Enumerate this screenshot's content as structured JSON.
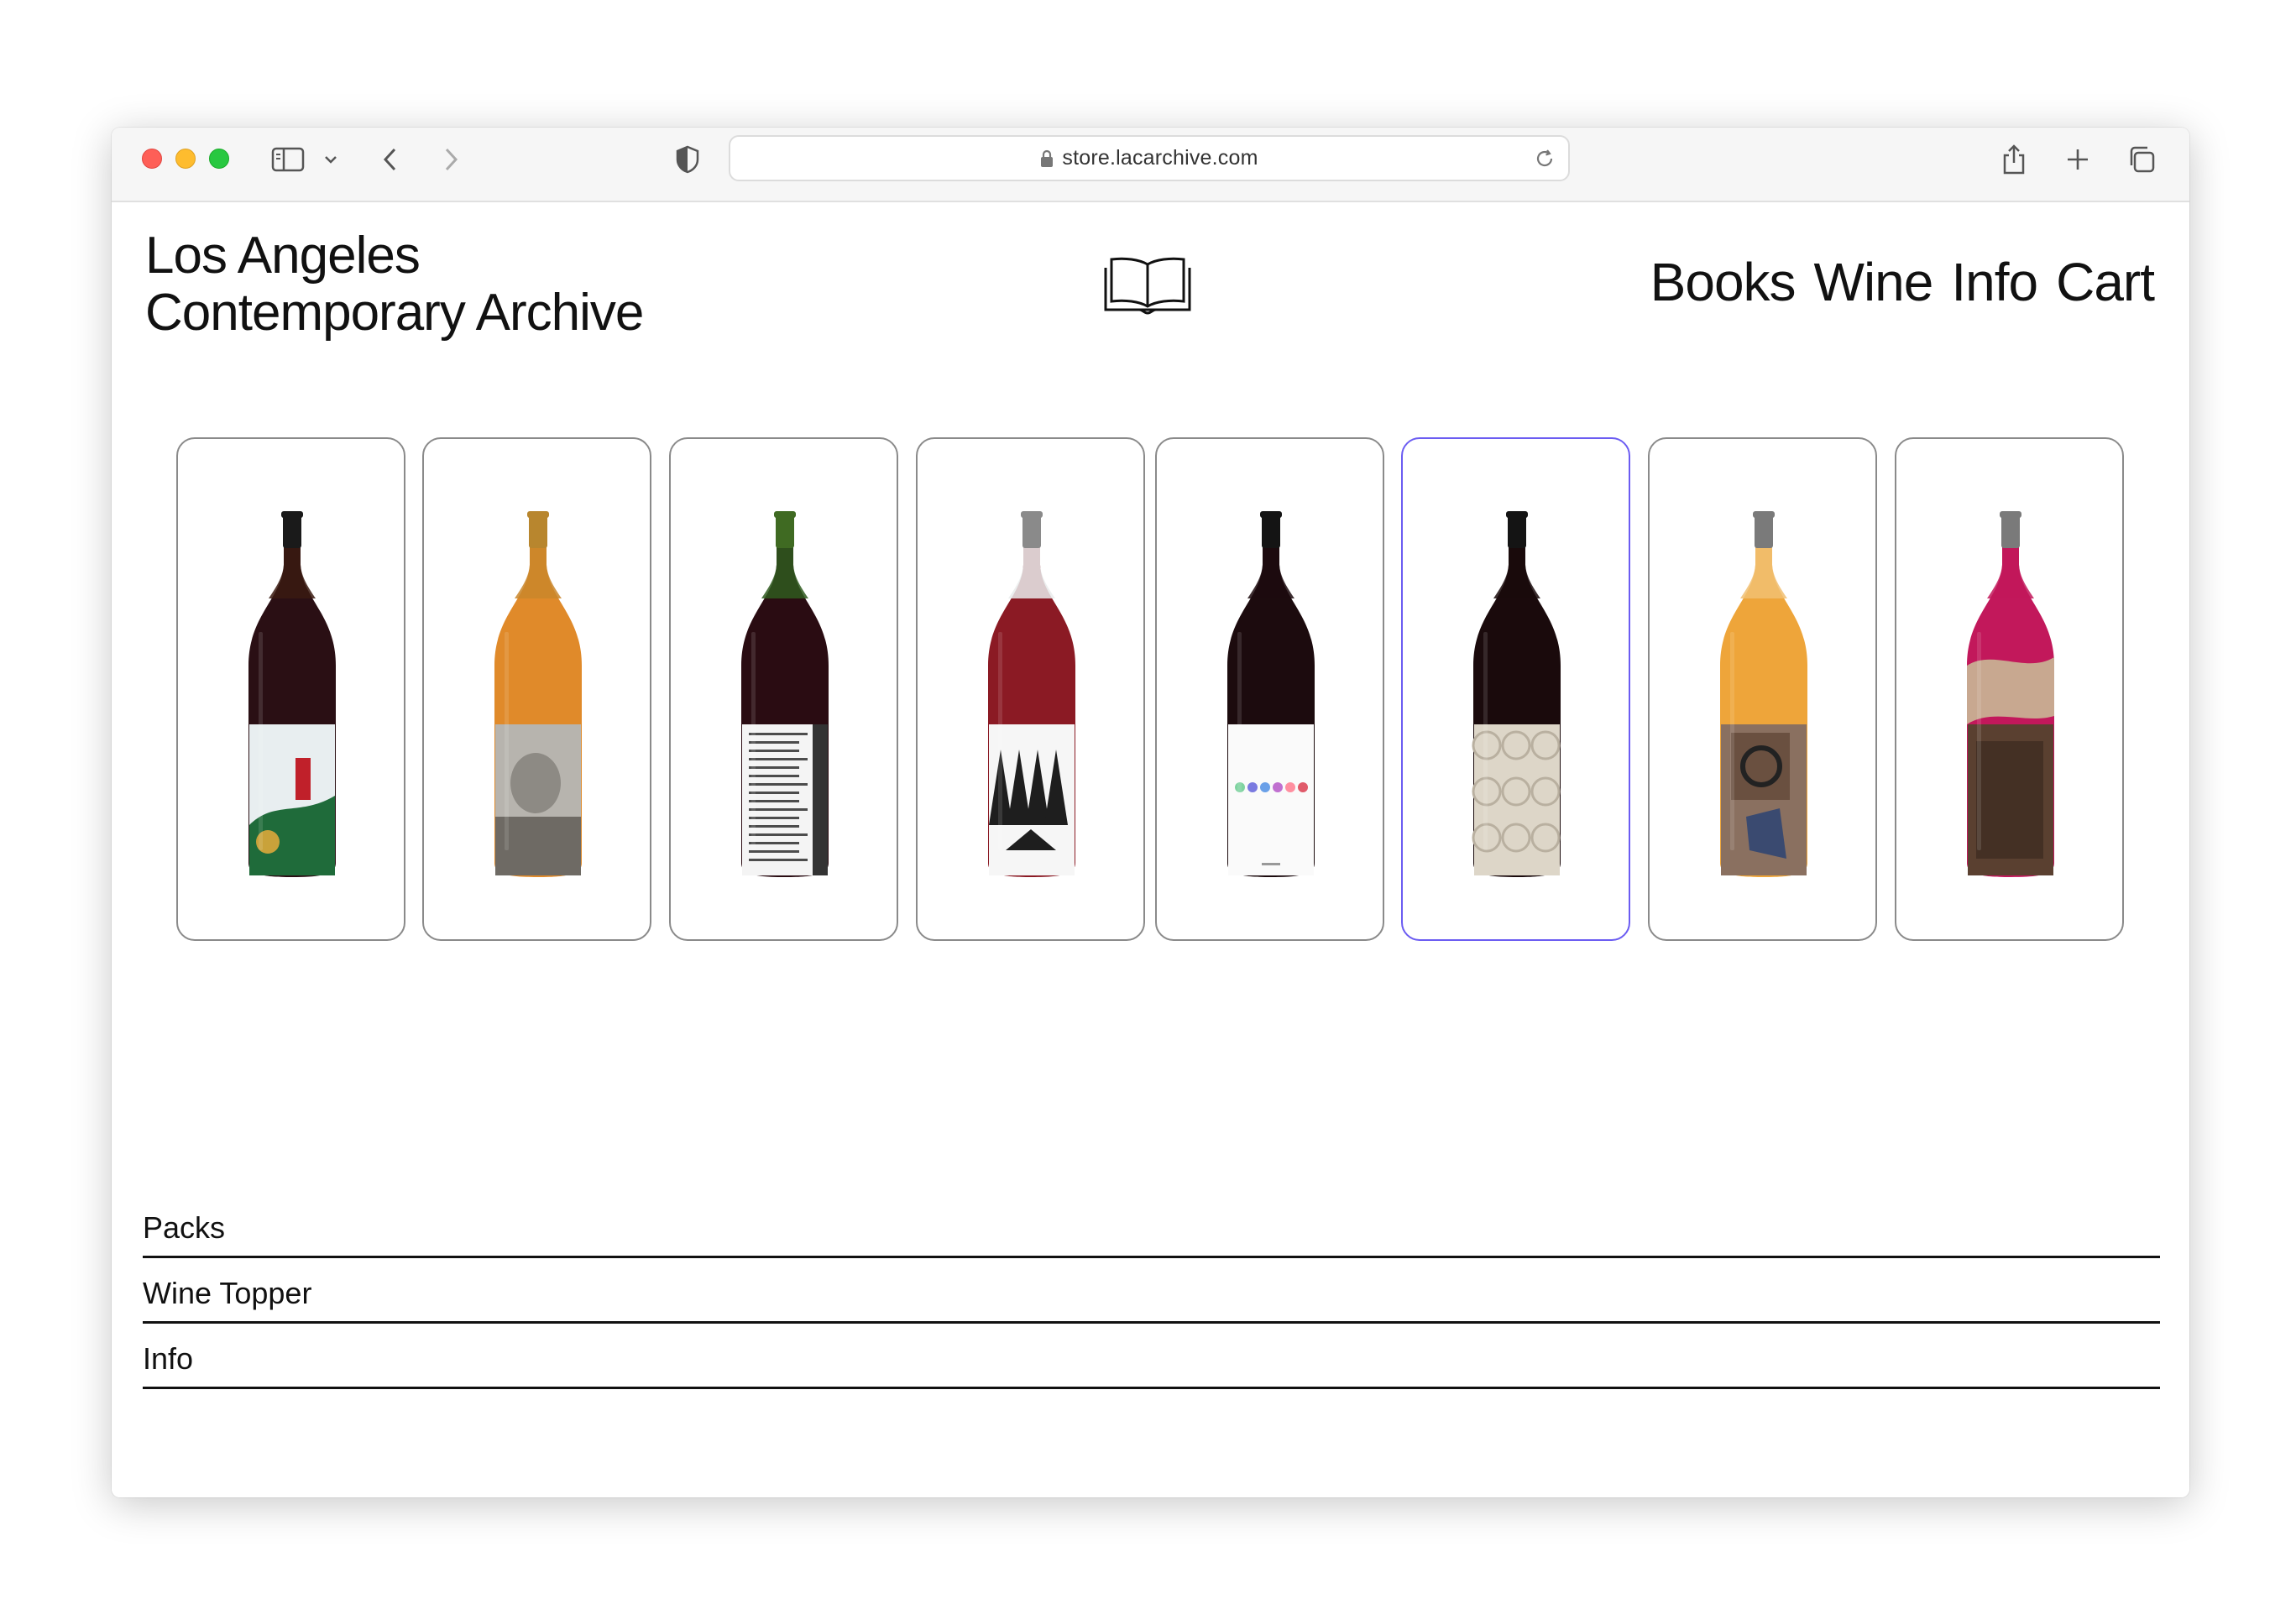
{
  "browser": {
    "url": "store.lacarchive.com"
  },
  "site": {
    "title_line1": "Los Angeles",
    "title_line2": "Contemporary Archive",
    "logo_icon": "open-book-icon",
    "nav": [
      "Books",
      "Wine",
      "Info",
      "Cart"
    ]
  },
  "products": [
    {
      "liquid": "#2a0f14",
      "neck": "#3a1a10",
      "label": "#e8eef0",
      "label_style": "painting",
      "cap": "#1a1a1a",
      "accent": "#c0202a"
    },
    {
      "liquid": "#e08a2a",
      "neck": "#c9862a",
      "label": "#b7b4ae",
      "label_style": "photo",
      "cap": "#b8862e",
      "accent": "#6e6a64"
    },
    {
      "liquid": "#2a0c12",
      "neck": "#2f5a1e",
      "label": "#f4f4f4",
      "label_style": "text",
      "cap": "#3f6a22",
      "accent": "#222222"
    },
    {
      "liquid": "#8b1a24",
      "neck": "#e9ecec",
      "label": "#f6f6f6",
      "label_style": "trees",
      "cap": "#8a8a8a",
      "accent": "#1e1e1e"
    },
    {
      "liquid": "#1c0b0e",
      "neck": "#1c0b0e",
      "label": "#fafafa",
      "label_style": "hearts",
      "cap": "#141414",
      "accent": "#7a7ae0"
    },
    {
      "liquid": "#1a0a0c",
      "neck": "#1a0a0c",
      "label": "#ddd6c8",
      "label_style": "pattern",
      "cap": "#141414",
      "accent": "#b9b0a0"
    },
    {
      "liquid": "#eea53a",
      "neck": "#f1c072",
      "label": "#8a7060",
      "label_style": "collage",
      "cap": "#7a7a7a",
      "accent": "#3a4a70"
    },
    {
      "liquid": "#c2185b",
      "neck": "#c2185b",
      "label": "#5a4030",
      "label_style": "torn",
      "cap": "#7a7a7a",
      "accent": "#c8a890"
    }
  ],
  "active_product_index": 5,
  "sections": [
    "Packs",
    "Wine Topper",
    "Info"
  ]
}
